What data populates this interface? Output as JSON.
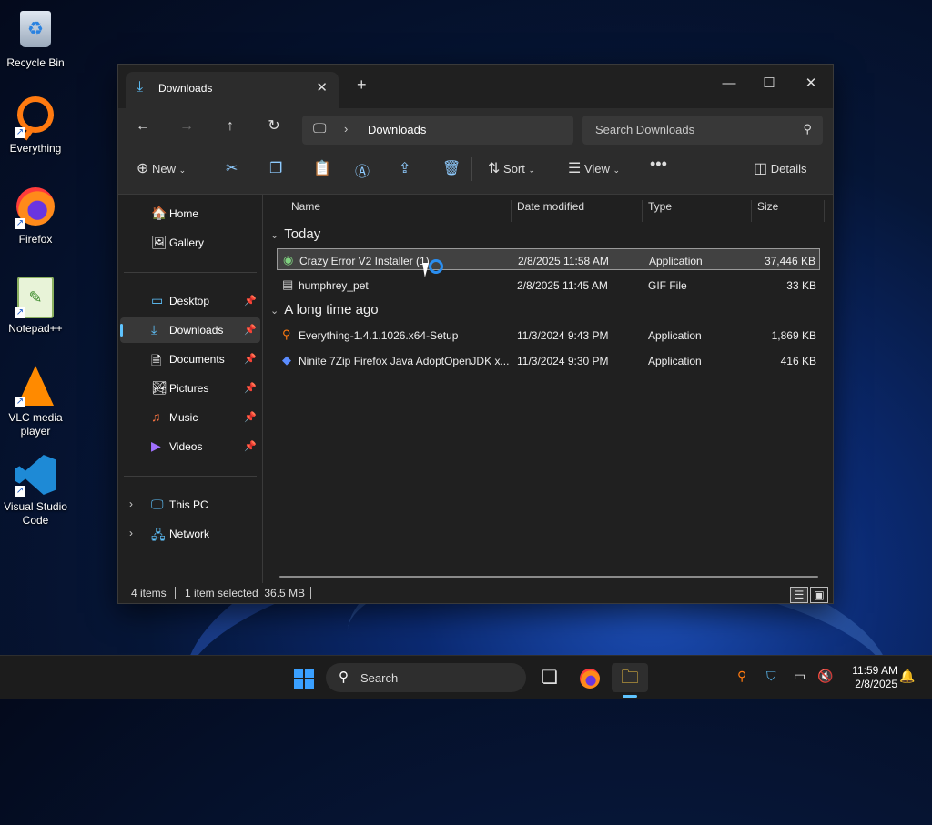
{
  "desktop": {
    "icons": [
      {
        "label": "Recycle Bin"
      },
      {
        "label": "Everything"
      },
      {
        "label": "Firefox"
      },
      {
        "label": "Notepad++"
      },
      {
        "label": "VLC media player"
      },
      {
        "label": "Visual Studio Code"
      }
    ]
  },
  "window": {
    "tab_title": "Downloads",
    "breadcrumb": "Downloads",
    "search_placeholder": "Search Downloads",
    "toolbar": {
      "new_label": "New",
      "sort_label": "Sort",
      "view_label": "View",
      "details_label": "Details"
    },
    "nav": {
      "home": "Home",
      "gallery": "Gallery",
      "desktop": "Desktop",
      "downloads": "Downloads",
      "documents": "Documents",
      "pictures": "Pictures",
      "music": "Music",
      "videos": "Videos",
      "this_pc": "This PC",
      "network": "Network"
    },
    "columns": {
      "name": "Name",
      "date": "Date modified",
      "type": "Type",
      "size": "Size"
    },
    "groups": {
      "today": "Today",
      "long_ago": "A long time ago"
    },
    "files": [
      {
        "name": "Crazy Error V2 Installer (1)",
        "date": "2/8/2025 11:58 AM",
        "type": "Application",
        "size": "37,446 KB"
      },
      {
        "name": "humphrey_pet",
        "date": "2/8/2025 11:45 AM",
        "type": "GIF File",
        "size": "33 KB"
      },
      {
        "name": "Everything-1.4.1.1026.x64-Setup",
        "date": "11/3/2024 9:43 PM",
        "type": "Application",
        "size": "1,869 KB"
      },
      {
        "name": "Ninite 7Zip Firefox Java AdoptOpenJDK x...",
        "date": "11/3/2024 9:30 PM",
        "type": "Application",
        "size": "416 KB"
      }
    ],
    "status": {
      "items": "4 items",
      "selected": "1 item selected  36.5 MB"
    }
  },
  "taskbar": {
    "search_label": "Search",
    "time": "11:59 AM",
    "date": "2/8/2025"
  },
  "colors": {
    "accent": "#5fc4ff",
    "window_bg": "#202020",
    "toolbar_bg": "#2c2c2c"
  }
}
